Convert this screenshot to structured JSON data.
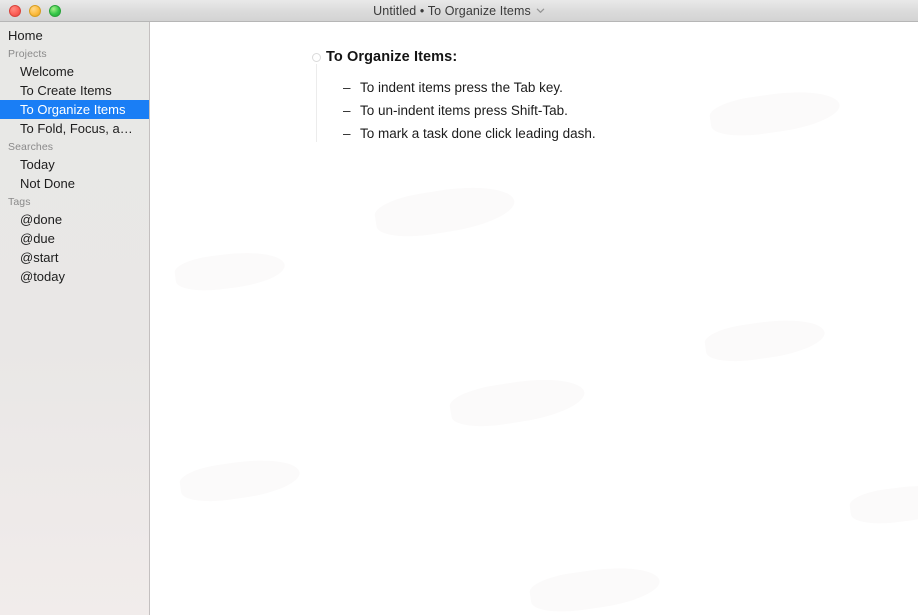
{
  "titlebar": {
    "title": "Untitled • To Organize Items",
    "chevron_icon": "chevron-down-icon",
    "traffic_lights": [
      {
        "name": "close",
        "color": "#fc5f57"
      },
      {
        "name": "minimize",
        "color": "#fdbc40"
      },
      {
        "name": "zoom",
        "color": "#34c749"
      }
    ]
  },
  "sidebar": {
    "home_label": "Home",
    "sections": [
      {
        "header": "Projects",
        "items": [
          {
            "label": "Welcome",
            "selected": false
          },
          {
            "label": "To Create Items",
            "selected": false
          },
          {
            "label": "To Organize Items",
            "selected": true
          },
          {
            "label": "To Fold, Focus, a…",
            "selected": false
          }
        ]
      },
      {
        "header": "Searches",
        "items": [
          {
            "label": "Today",
            "selected": false
          },
          {
            "label": "Not Done",
            "selected": false
          }
        ]
      },
      {
        "header": "Tags",
        "items": [
          {
            "label": "@done",
            "selected": false
          },
          {
            "label": "@due",
            "selected": false
          },
          {
            "label": "@start",
            "selected": false
          },
          {
            "label": "@today",
            "selected": false
          }
        ]
      }
    ],
    "selection_color": "#1a7ef5",
    "background_color": "#e8e8e6"
  },
  "content": {
    "heading": "To Organize Items:",
    "bullet_marker": "–",
    "items": [
      {
        "text": "To indent items press the Tab key."
      },
      {
        "text": "To un-indent items press Shift-Tab."
      },
      {
        "text": "To mark a task done click leading dash."
      }
    ]
  }
}
